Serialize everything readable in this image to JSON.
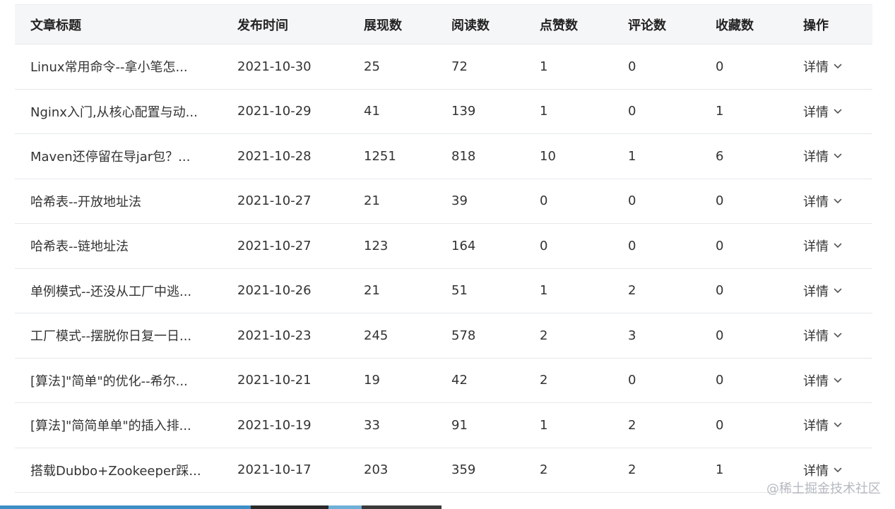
{
  "table": {
    "headers": [
      "文章标题",
      "发布时间",
      "展现数",
      "阅读数",
      "点赞数",
      "评论数",
      "收藏数",
      "操作"
    ],
    "rows": [
      {
        "title": "Linux常用命令--拿小笔怎...",
        "date": "2021-10-30",
        "impressions": "25",
        "reads": "72",
        "likes": "1",
        "comments": "0",
        "favorites": "0",
        "action": "详情"
      },
      {
        "title": "Nginx入门,从核心配置与动...",
        "date": "2021-10-29",
        "impressions": "41",
        "reads": "139",
        "likes": "1",
        "comments": "0",
        "favorites": "1",
        "action": "详情"
      },
      {
        "title": "Maven还停留在导jar包？...",
        "date": "2021-10-28",
        "impressions": "1251",
        "reads": "818",
        "likes": "10",
        "comments": "1",
        "favorites": "6",
        "action": "详情"
      },
      {
        "title": "哈希表--开放地址法",
        "date": "2021-10-27",
        "impressions": "21",
        "reads": "39",
        "likes": "0",
        "comments": "0",
        "favorites": "0",
        "action": "详情"
      },
      {
        "title": "哈希表--链地址法",
        "date": "2021-10-27",
        "impressions": "123",
        "reads": "164",
        "likes": "0",
        "comments": "0",
        "favorites": "0",
        "action": "详情"
      },
      {
        "title": "单例模式--还没从工厂中逃...",
        "date": "2021-10-26",
        "impressions": "21",
        "reads": "51",
        "likes": "1",
        "comments": "2",
        "favorites": "0",
        "action": "详情"
      },
      {
        "title": "工厂模式--摆脱你日复一日...",
        "date": "2021-10-23",
        "impressions": "245",
        "reads": "578",
        "likes": "2",
        "comments": "3",
        "favorites": "0",
        "action": "详情"
      },
      {
        "title": "[算法]\"简单\"的优化--希尔...",
        "date": "2021-10-21",
        "impressions": "19",
        "reads": "42",
        "likes": "2",
        "comments": "0",
        "favorites": "0",
        "action": "详情"
      },
      {
        "title": "[算法]\"简简单单\"的插入排...",
        "date": "2021-10-19",
        "impressions": "33",
        "reads": "91",
        "likes": "1",
        "comments": "2",
        "favorites": "0",
        "action": "详情"
      },
      {
        "title": "搭载Dubbo+Zookeeper踩...",
        "date": "2021-10-17",
        "impressions": "203",
        "reads": "359",
        "likes": "2",
        "comments": "2",
        "favorites": "1",
        "action": "详情"
      }
    ]
  },
  "watermark": "@稀土掘金技术社区",
  "icons": {
    "action_expand": "chevron-down-icon"
  },
  "colors": {
    "header_bg": "#f5f6f7",
    "row_border": "#e6e8eb",
    "text": "#333333",
    "watermark": "#b5b9bf",
    "strip": [
      "#3d8fc6",
      "#2a2a2a",
      "#6fb0d8",
      "#3a3a3a"
    ]
  }
}
